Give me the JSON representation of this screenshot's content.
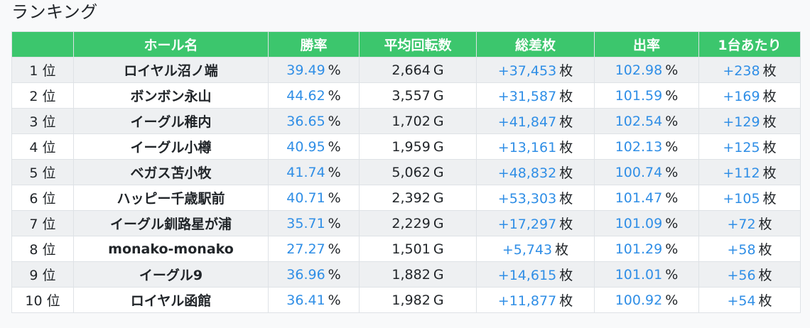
{
  "page": {
    "title": "ランキング"
  },
  "table": {
    "headers": [
      "",
      "ホール名",
      "勝率",
      "平均回転数",
      "総差枚",
      "出率",
      "1台あたり"
    ],
    "units": {
      "win_rate": "%",
      "avg_spins": "G",
      "total_diff": "枚",
      "payout": "%",
      "per_machine": "枚"
    },
    "rows": [
      {
        "rank": "1 位",
        "hall": "ロイヤル沼ノ端",
        "win_rate": "39.49",
        "avg_spins": "2,664",
        "total_diff": "+37,453",
        "payout": "102.98",
        "per_machine": "+238"
      },
      {
        "rank": "2 位",
        "hall": "ボンボン永山",
        "win_rate": "44.62",
        "avg_spins": "3,557",
        "total_diff": "+31,587",
        "payout": "101.59",
        "per_machine": "+169"
      },
      {
        "rank": "3 位",
        "hall": "イーグル稚内",
        "win_rate": "36.65",
        "avg_spins": "1,702",
        "total_diff": "+41,847",
        "payout": "102.54",
        "per_machine": "+129"
      },
      {
        "rank": "4 位",
        "hall": "イーグル小樽",
        "win_rate": "40.95",
        "avg_spins": "1,959",
        "total_diff": "+13,161",
        "payout": "102.13",
        "per_machine": "+125"
      },
      {
        "rank": "5 位",
        "hall": "ベガス苫小牧",
        "win_rate": "41.74",
        "avg_spins": "5,062",
        "total_diff": "+48,832",
        "payout": "100.74",
        "per_machine": "+112"
      },
      {
        "rank": "6 位",
        "hall": "ハッピー千歳駅前",
        "win_rate": "40.71",
        "avg_spins": "2,392",
        "total_diff": "+53,303",
        "payout": "101.47",
        "per_machine": "+105"
      },
      {
        "rank": "7 位",
        "hall": "イーグル釧路星が浦",
        "win_rate": "35.71",
        "avg_spins": "2,229",
        "total_diff": "+17,297",
        "payout": "101.09",
        "per_machine": "+72"
      },
      {
        "rank": "8 位",
        "hall": "monako-monako",
        "win_rate": "27.27",
        "avg_spins": "1,501",
        "total_diff": "+5,743",
        "payout": "101.29",
        "per_machine": "+58"
      },
      {
        "rank": "9 位",
        "hall": "イーグル9",
        "win_rate": "36.96",
        "avg_spins": "1,882",
        "total_diff": "+14,615",
        "payout": "101.01",
        "per_machine": "+56"
      },
      {
        "rank": "10 位",
        "hall": "ロイヤル函館",
        "win_rate": "36.41",
        "avg_spins": "1,982",
        "total_diff": "+11,877",
        "payout": "100.92",
        "per_machine": "+54"
      }
    ]
  },
  "colors": {
    "header_bg": "#3cc66d",
    "header_text": "#ffffff",
    "value_blue": "#2f8ee6",
    "row_stripe": "#eef0f2",
    "page_bg": "#f8f9fa"
  }
}
